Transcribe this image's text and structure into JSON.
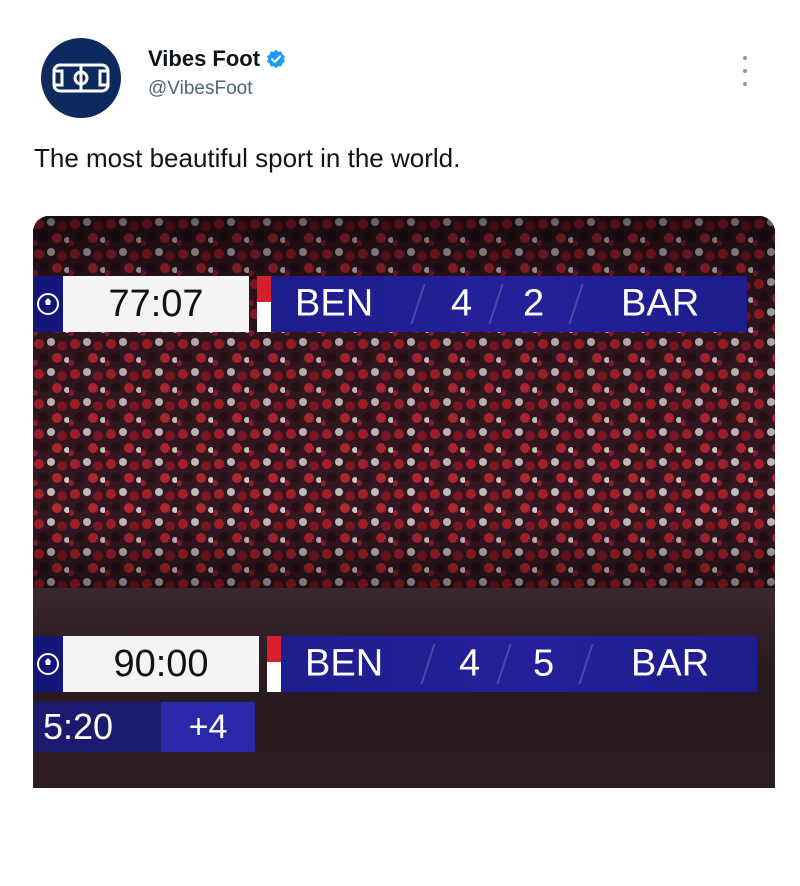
{
  "tweet": {
    "author": {
      "display_name": "Vibes Foot",
      "handle": "@VibesFoot",
      "verified": true,
      "avatar_icon": "football-pitch-icon",
      "avatar_color": "#0d2a5e",
      "verified_color": "#1d9bf0"
    },
    "more_icon": "more-vertical-icon",
    "text": "The most beautiful sport in the world."
  },
  "media": {
    "scoreboard_top": {
      "competition_icon": "champions-league-icon",
      "clock": "77:07",
      "home": "BEN",
      "home_score": "4",
      "away_score": "2",
      "away": "BAR"
    },
    "scoreboard_bottom": {
      "competition_icon": "champions-league-icon",
      "clock": "90:00",
      "home": "BEN",
      "home_score": "4",
      "away_score": "5",
      "away": "BAR",
      "stoppage_elapsed": "5:20",
      "stoppage_added": "+4"
    },
    "colors": {
      "scoreboard_blue": "#1e1d8c",
      "benfica_red": "#d8202c",
      "crowd_red": "#b8232e"
    }
  }
}
